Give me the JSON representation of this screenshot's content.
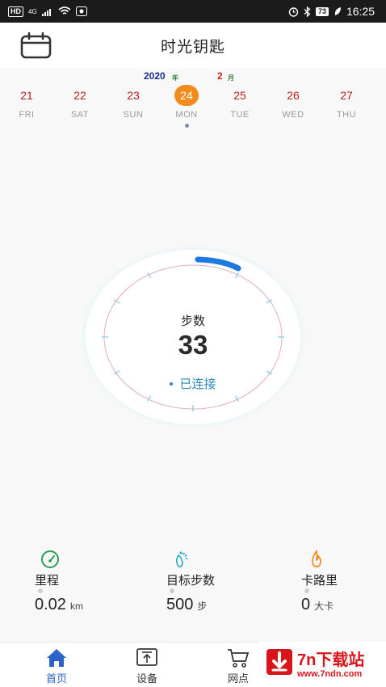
{
  "status_bar": {
    "left_badge": "HD",
    "network": "4G",
    "battery": "73",
    "time": "16:25"
  },
  "header": {
    "title": "时光钥匙"
  },
  "date_strip": {
    "year": "2020",
    "year_unit": "年",
    "month": "2",
    "month_unit": "月",
    "days": [
      {
        "num": "21",
        "weekday": "FRI"
      },
      {
        "num": "22",
        "weekday": "SAT"
      },
      {
        "num": "23",
        "weekday": "SUN"
      },
      {
        "num": "24",
        "weekday": "MON"
      },
      {
        "num": "25",
        "weekday": "TUE"
      },
      {
        "num": "26",
        "weekday": "WED"
      },
      {
        "num": "27",
        "weekday": "THU"
      }
    ],
    "selected_index": 3
  },
  "ring": {
    "label": "步数",
    "steps": "33",
    "status": "已连接",
    "progress_color": "#1e78e0"
  },
  "stats": [
    {
      "title": "里程",
      "value": "0.02",
      "unit": "km",
      "icon": "speedometer-icon",
      "color": "#2e9e52"
    },
    {
      "title": "目标步数",
      "value": "500",
      "unit": "步",
      "icon": "footprint-icon",
      "color": "#2aa6c8"
    },
    {
      "title": "卡路里",
      "value": "0",
      "unit": "大卡",
      "icon": "flame-icon",
      "color": "#f08a24"
    }
  ],
  "nav": {
    "items": [
      {
        "label": "首页",
        "icon": "home-icon",
        "active": true
      },
      {
        "label": "设备",
        "icon": "device-upload-icon",
        "active": false
      },
      {
        "label": "网点",
        "icon": "cart-icon",
        "active": false
      }
    ]
  },
  "watermark": {
    "name": "7n下载站",
    "url": "www.7ndn.com"
  },
  "colors": {
    "accent": "#f28c1c",
    "active_nav": "#2b63c9",
    "brand_red": "#d9141b"
  }
}
